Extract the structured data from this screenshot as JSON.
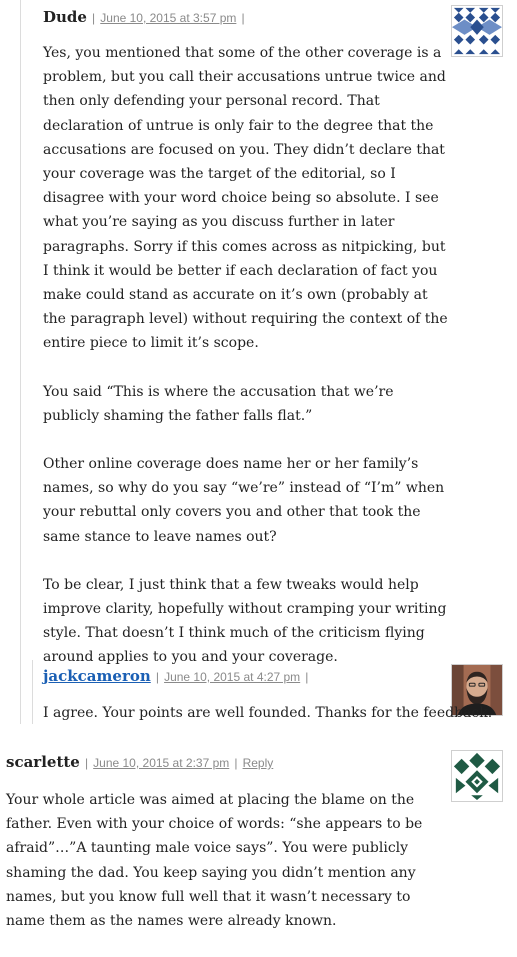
{
  "comments": [
    {
      "author": "Dude",
      "date": "June 10, 2015 at 3:57 pm",
      "sep_left": "|",
      "sep_right": "|",
      "avatar_icon": "blue-quilt-pattern-avatar",
      "paragraphs": [
        "Yes, you mentioned that some of the other coverage is a problem, but you call their accusations untrue twice and then only defending your personal record. That declaration of untrue is only fair to the degree that the accusations are focused on you. They didn’t declare that your coverage was the target of the editorial, so I disagree with your word choice being so absolute. I see what you’re saying as you discuss further in later paragraphs. Sorry if this comes across as nitpicking, but I think it would be better if each declaration of fact you make could stand as accurate on it’s own (probably at the paragraph level) without requiring the context of the entire piece to limit it’s scope.",
        "You said “This is where the accusation that we’re publicly shaming the father falls flat.”",
        "Other online coverage does name her or her family’s names, so why do you say “we’re” instead of “I’m” when your rebuttal only covers you and other that took the same stance to leave names out?",
        "To be clear, I just think that a few tweaks would help improve clarity, hopefully without cramping your writing style. That doesn’t I think much of the criticism flying around applies to you and your coverage."
      ]
    },
    {
      "author": "jackcameron",
      "date": "June 10, 2015 at 4:27 pm",
      "sep_left": "|",
      "sep_right": "|",
      "avatar_icon": "bearded-man-photo-avatar",
      "paragraphs": [
        "I agree. Your points are well founded. Thanks for the feedback."
      ]
    },
    {
      "author": "scarlette",
      "date": "June 10, 2015 at 2:37 pm",
      "sep_left": "|",
      "sep_right": "|",
      "reply_label": "Reply",
      "avatar_icon": "green-geometric-pattern-avatar",
      "paragraphs": [
        "Your whole article was aimed at placing the blame on the father. Even with your choice of words: “she appears to be afraid”…”A taunting male voice says”. You were publicly shaming the dad. You keep saying you didn’t mention any names, but you know full well that it wasn’t necessary to name them as the names were already known."
      ]
    }
  ],
  "colors": {
    "link": "#1a5fb4",
    "meta": "#8a8a8a",
    "text": "#222222",
    "thread_line": "#dcdcdc"
  }
}
